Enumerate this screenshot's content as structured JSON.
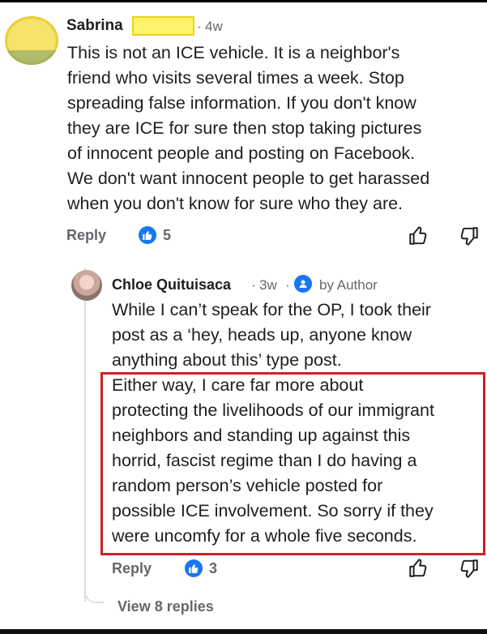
{
  "comment": {
    "author": "Sabrina",
    "time": "4w",
    "separator": "·",
    "paragraph_lines": [
      "This is not an ICE vehicle. It is a neighbor's",
      "friend who visits several times a week. Stop",
      "spreading false information. If you don't know",
      "they are ICE for sure then stop taking pictures",
      "of innocent people and posting on Facebook.",
      "We don't want innocent people to get harassed",
      "when you don't know for sure who they are."
    ],
    "reply_label": "Reply",
    "like_count": "5"
  },
  "reply": {
    "author": "Chloe Quituisaca",
    "time": "3w",
    "separator": "·",
    "badge": "by Author",
    "paragraph_lines": [
      "While I can’t speak for the OP, I took their",
      "post as a ‘hey, heads up, anyone know",
      "anything about this’ type post.",
      "Either way, I care far more about",
      "protecting the livelihoods of our immigrant",
      "neighbors and standing up against this",
      "horrid, fascist regime than I do having a",
      "random person’s vehicle posted for",
      "possible ICE involvement.  So sorry if they",
      "were uncomfy for a whole five seconds."
    ],
    "reply_label": "Reply",
    "like_count": "3"
  },
  "thread": {
    "view_replies_label": "View 8 replies"
  },
  "colors": {
    "accent_blue": "#1877f2",
    "highlight_red": "#d21f26",
    "redaction_yellow": "#fff36b"
  },
  "icons": [
    "like-reaction-icon",
    "thumbs-up-icon",
    "thumbs-down-icon",
    "author-badge-icon"
  ]
}
